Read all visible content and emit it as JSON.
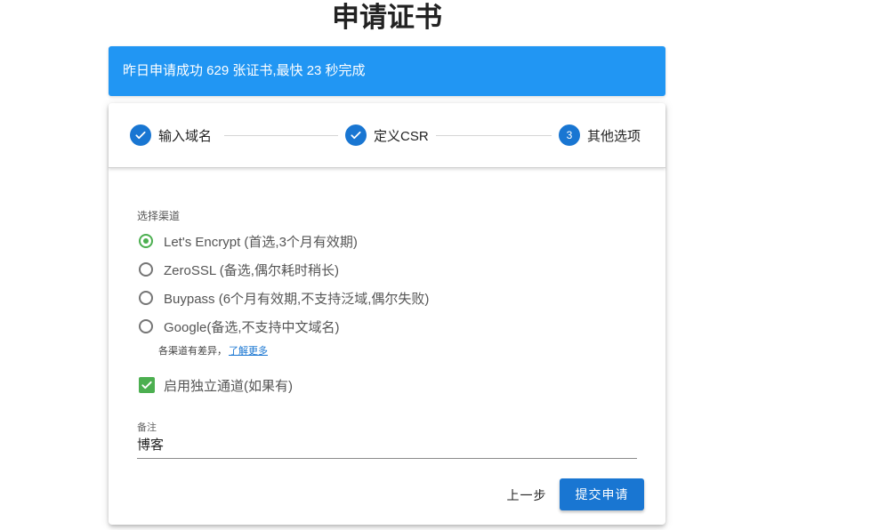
{
  "page": {
    "title": "申请证书"
  },
  "banner": {
    "text": "昨日申请成功 629 张证书,最快 23 秒完成"
  },
  "stepper": {
    "steps": [
      {
        "label": "输入域名",
        "state": "done",
        "icon": "check-icon"
      },
      {
        "label": "定义CSR",
        "state": "done",
        "icon": "check-icon"
      },
      {
        "label": "其他选项",
        "state": "active",
        "number": "3"
      }
    ]
  },
  "channel": {
    "label": "选择渠道",
    "options": [
      {
        "label": "Let's Encrypt (首选,3个月有效期)",
        "selected": true
      },
      {
        "label": "ZeroSSL (备选,偶尔耗时稍长)",
        "selected": false
      },
      {
        "label": "Buypass (6个月有效期,不支持泛域,偶尔失败)",
        "selected": false
      },
      {
        "label": "Google(备选,不支持中文域名)",
        "selected": false
      }
    ],
    "hint": "各渠道有差异，",
    "hint_link": "了解更多"
  },
  "dedicated": {
    "label": "启用独立通道(如果有)",
    "checked": true
  },
  "remark": {
    "label": "备注",
    "value": "博客"
  },
  "actions": {
    "back": "上一步",
    "submit": "提交申请"
  },
  "colors": {
    "primary": "#1976d2",
    "banner": "#2196f3",
    "success": "#4caf50"
  }
}
